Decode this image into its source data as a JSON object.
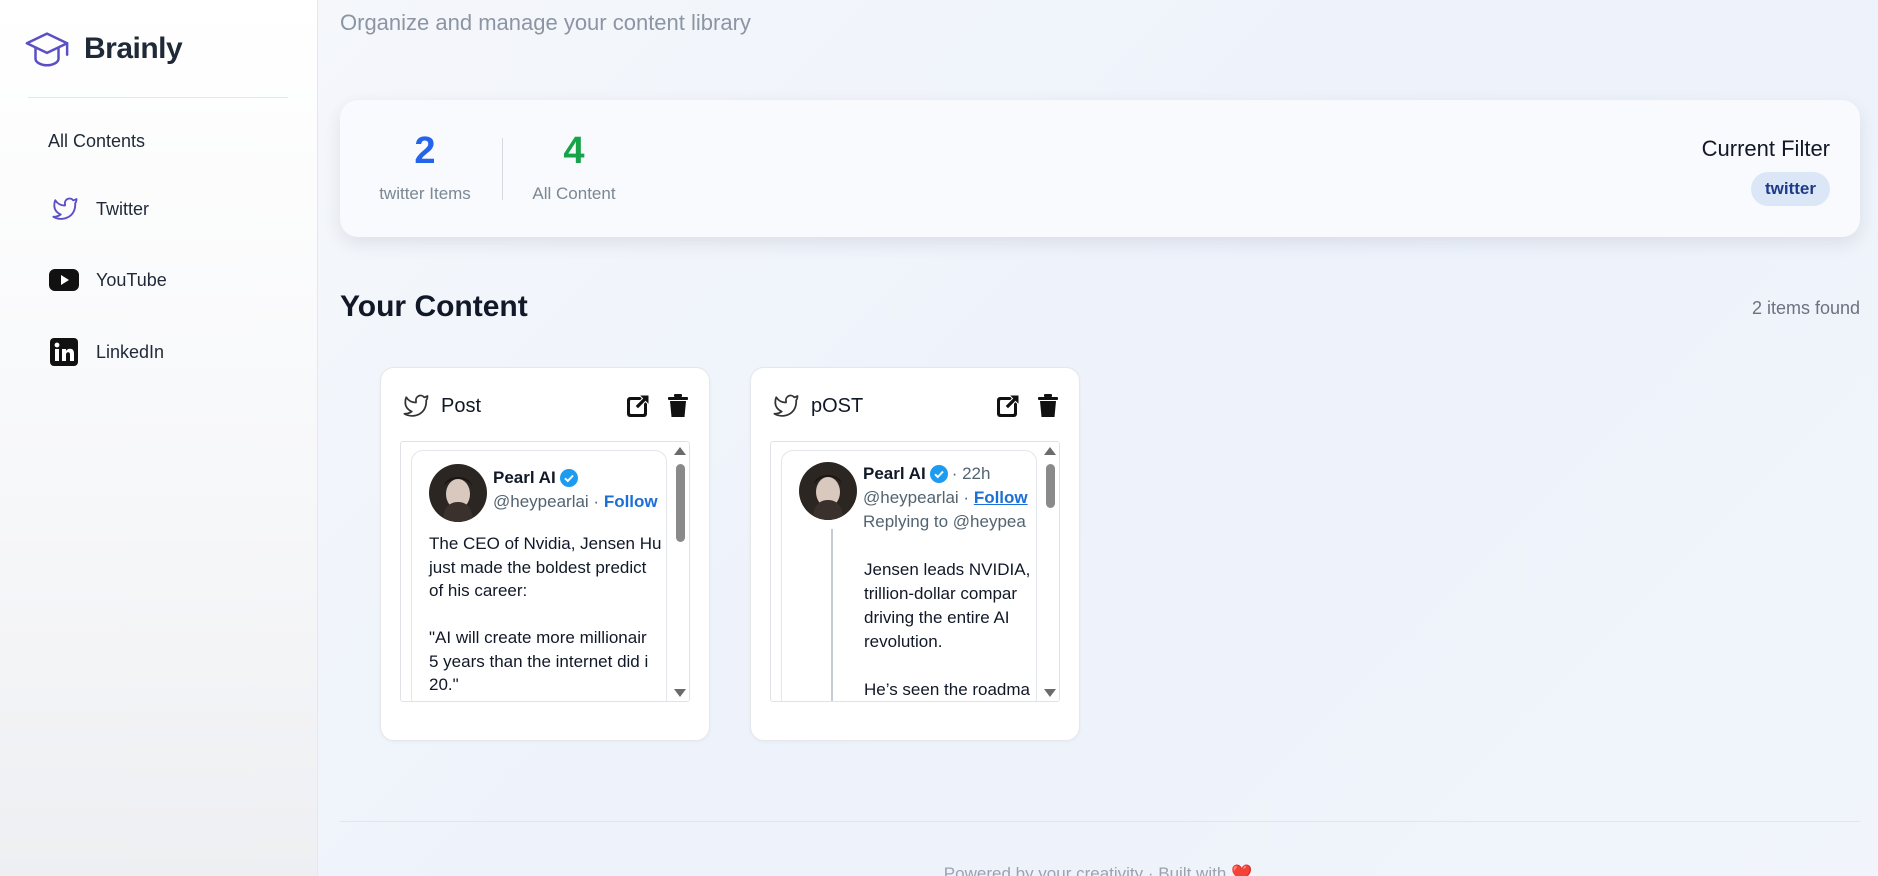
{
  "brand": {
    "name": "Brainly",
    "accent": "#5b4fc4"
  },
  "sidebar": {
    "items": [
      {
        "label": "All Contents",
        "icon": ""
      },
      {
        "label": "Twitter",
        "icon": "twitter-bird-icon"
      },
      {
        "label": "YouTube",
        "icon": "youtube-icon"
      },
      {
        "label": "LinkedIn",
        "icon": "linkedin-icon"
      }
    ]
  },
  "main": {
    "subtitle": "Organize and manage your content library",
    "stats": [
      {
        "value": "2",
        "label": "twitter Items",
        "color": "#2563eb"
      },
      {
        "value": "4",
        "label": "All Content",
        "color": "#16a34a"
      }
    ],
    "filter": {
      "title": "Current Filter",
      "value": "twitter"
    },
    "section_title": "Your Content",
    "items_found": "2 items found",
    "cards": [
      {
        "title": "Post",
        "tweet": {
          "name": "Pearl AI",
          "handle": "@heypearlai",
          "follow": "Follow",
          "time": "",
          "reply_to": "",
          "body": "The CEO of Nvidia, Jensen Hu\njust made the boldest predict\nof his career:\n\n\"AI will create more millionair\n5 years than the internet did i\n20.\""
        }
      },
      {
        "title": "pOST",
        "tweet": {
          "name": "Pearl AI",
          "handle": "@heypearlai",
          "follow": "Follow",
          "time": "· 22h",
          "reply_to": "Replying to @heypea",
          "body": "Jensen leads NVIDIA,\ntrillion-dollar compar\ndriving the entire AI\nrevolution.\n\nHe’s seen the roadma\nall the major AI playe"
        }
      }
    ],
    "footer": "Powered by your creativity · Built with ❤️"
  }
}
